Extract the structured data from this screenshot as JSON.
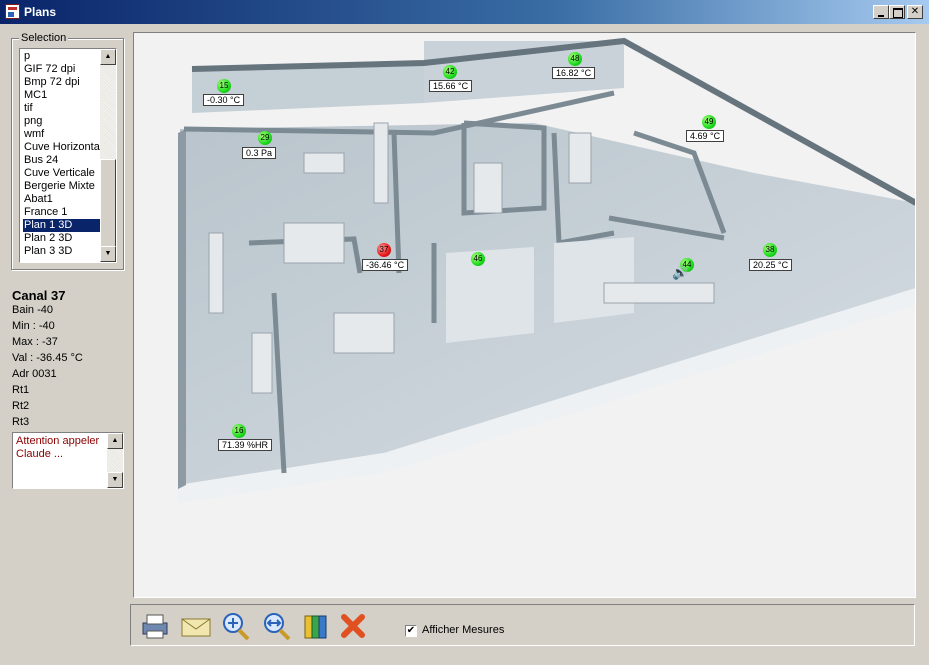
{
  "window": {
    "title": "Plans",
    "min_glyph": "",
    "max_glyph": "",
    "close_glyph": "✕"
  },
  "selection": {
    "legend": "Selection",
    "items": [
      "p",
      "GIF 72 dpi",
      "Bmp 72 dpi",
      "MC1",
      "tif",
      "png",
      "wmf",
      "Cuve Horizontal",
      "Bus 24",
      "Cuve Verticale",
      "Bergerie Mixte",
      "Abat1",
      "France 1",
      "Plan 1 3D",
      "Plan 2 3D",
      "Plan 3 3D"
    ],
    "selected": "Plan 1 3D",
    "scroll_up": "▲",
    "scroll_down": "▼"
  },
  "channel": {
    "title": "Canal 37",
    "lines": [
      "Bain -40",
      "Min : -40",
      "Max : -37",
      "Val : -36.45 °C",
      "Adr 0031",
      "Rt1",
      "Rt2",
      "Rt3"
    ]
  },
  "memo": {
    "lines": [
      "Attention appeler",
      "Claude ..."
    ]
  },
  "sensors": [
    {
      "id": "15",
      "value": "-0.30 °C",
      "alarm": false
    },
    {
      "id": "42",
      "value": "15.66 °C",
      "alarm": false
    },
    {
      "id": "48",
      "value": "16.82 °C",
      "alarm": false
    },
    {
      "id": "29",
      "value": "0.3 Pa",
      "alarm": false
    },
    {
      "id": "49",
      "value": "4.69 °C",
      "alarm": false
    },
    {
      "id": "37",
      "value": "-36.46 °C",
      "alarm": true
    },
    {
      "id": "46",
      "value": "",
      "alarm": false
    },
    {
      "id": "44",
      "value": "",
      "alarm": false
    },
    {
      "id": "38",
      "value": "20.25 °C",
      "alarm": false
    },
    {
      "id": "16",
      "value": "71.39 %HR",
      "alarm": false
    }
  ],
  "toolbar": {
    "buttons": [
      "printer-icon",
      "mail-icon",
      "zoom-in-icon",
      "zoom-fit-icon",
      "columns-icon",
      "close-plan-icon"
    ],
    "show_measures_label": "Afficher Mesures",
    "show_measures_checked": true,
    "check_glyph": "✔"
  },
  "colors": {
    "titlebar": "#0a246a",
    "selection": "#0a246a",
    "sensor_ok": "#1cdb1c",
    "sensor_alarm": "#e81818",
    "memo_text": "#8b0000"
  }
}
